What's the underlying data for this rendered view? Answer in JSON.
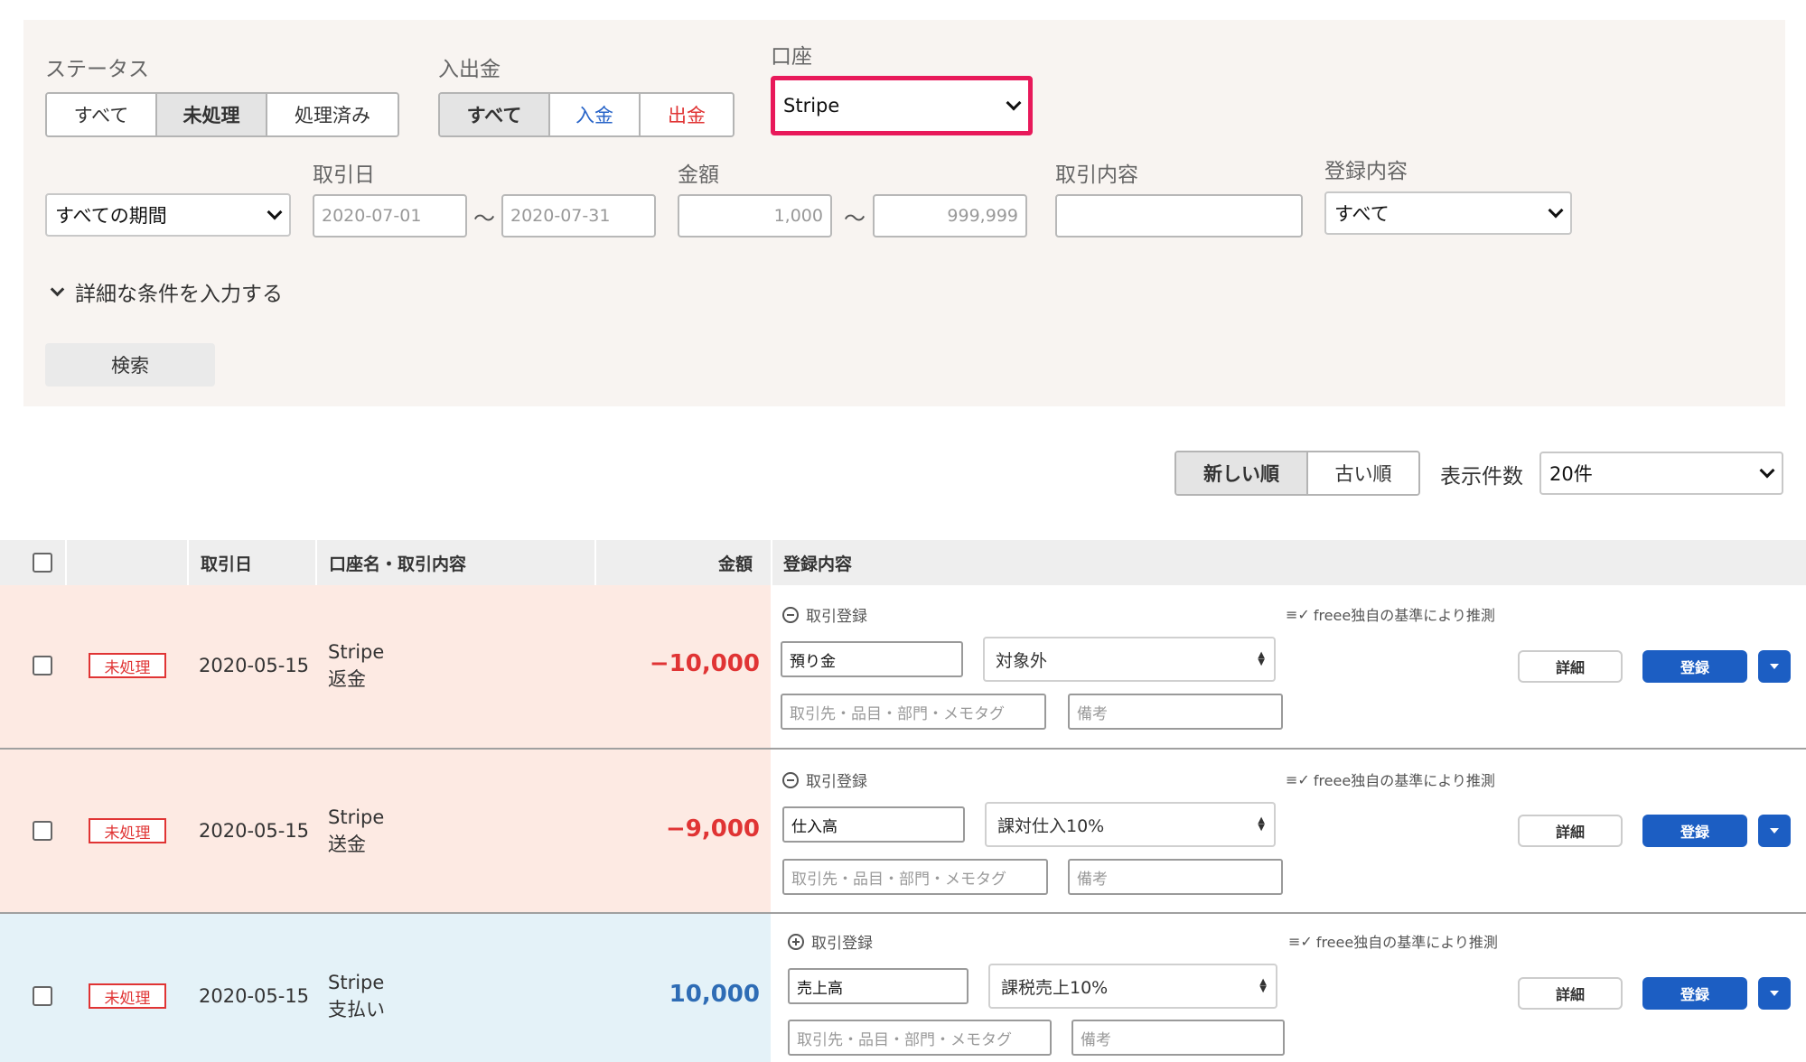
{
  "filters": {
    "status": {
      "label": "ステータス",
      "options": [
        "すべて",
        "未処理",
        "処理済み"
      ],
      "selected": "未処理"
    },
    "inout": {
      "label": "入出金",
      "options": [
        "すべて",
        "入金",
        "出金"
      ],
      "selected": "すべて"
    },
    "account": {
      "label": "口座",
      "value": "Stripe"
    },
    "period": {
      "value": "すべての期間"
    },
    "date": {
      "label": "取引日",
      "from": "2020-07-01",
      "to": "2020-07-31",
      "separator": "〜"
    },
    "amount": {
      "label": "金額",
      "min": "1,000",
      "max": "999,999",
      "separator": "〜"
    },
    "description": {
      "label": "取引内容",
      "value": ""
    },
    "registration": {
      "label": "登録内容",
      "value": "すべて"
    },
    "advanced_toggle": "詳細な条件を入力する",
    "search_button": "検索"
  },
  "sort": {
    "newest": "新しい順",
    "oldest": "古い順",
    "selected": "新しい順",
    "count_label": "表示件数",
    "count_value": "20件"
  },
  "table": {
    "headers": {
      "date": "取引日",
      "account_desc": "口座名・取引内容",
      "amount": "金額",
      "registration": "登録内容"
    },
    "rows": [
      {
        "status": "未処理",
        "date": "2020-05-15",
        "account": "Stripe",
        "description": "返金",
        "amount": "−10,000",
        "amount_sign": "negative",
        "reg_label": "取引登録",
        "reg_icon": "minus-circle-icon",
        "guess_text": "freee独自の基準により推測",
        "item": "預り金",
        "tax": "対象外",
        "tags_placeholder": "取引先・品目・部門・メモタグ",
        "note_placeholder": "備考",
        "detail_label": "詳細",
        "register_label": "登録"
      },
      {
        "status": "未処理",
        "date": "2020-05-15",
        "account": "Stripe",
        "description": "送金",
        "amount": "−9,000",
        "amount_sign": "negative",
        "reg_label": "取引登録",
        "reg_icon": "minus-circle-icon",
        "guess_text": "freee独自の基準により推測",
        "item": "仕入高",
        "tax": "課対仕入10%",
        "tags_placeholder": "取引先・品目・部門・メモタグ",
        "note_placeholder": "備考",
        "detail_label": "詳細",
        "register_label": "登録"
      },
      {
        "status": "未処理",
        "date": "2020-05-15",
        "account": "Stripe",
        "description": "支払い",
        "amount": "10,000",
        "amount_sign": "positive",
        "reg_label": "取引登録",
        "reg_icon": "plus-circle-icon",
        "guess_text": "freee独自の基準により推測",
        "item": "売上高",
        "tax": "課税売上10%",
        "tags_placeholder": "取引先・品目・部門・メモタグ",
        "note_placeholder": "備考",
        "detail_label": "詳細",
        "register_label": "登録"
      }
    ]
  },
  "colors": {
    "highlight": "#e8195a",
    "primary": "#1c5ec3",
    "negative": "#e03434",
    "positive": "#2e6cb5",
    "unprocessed_row": "#fdeae3",
    "income_row": "#e4f2f8"
  }
}
